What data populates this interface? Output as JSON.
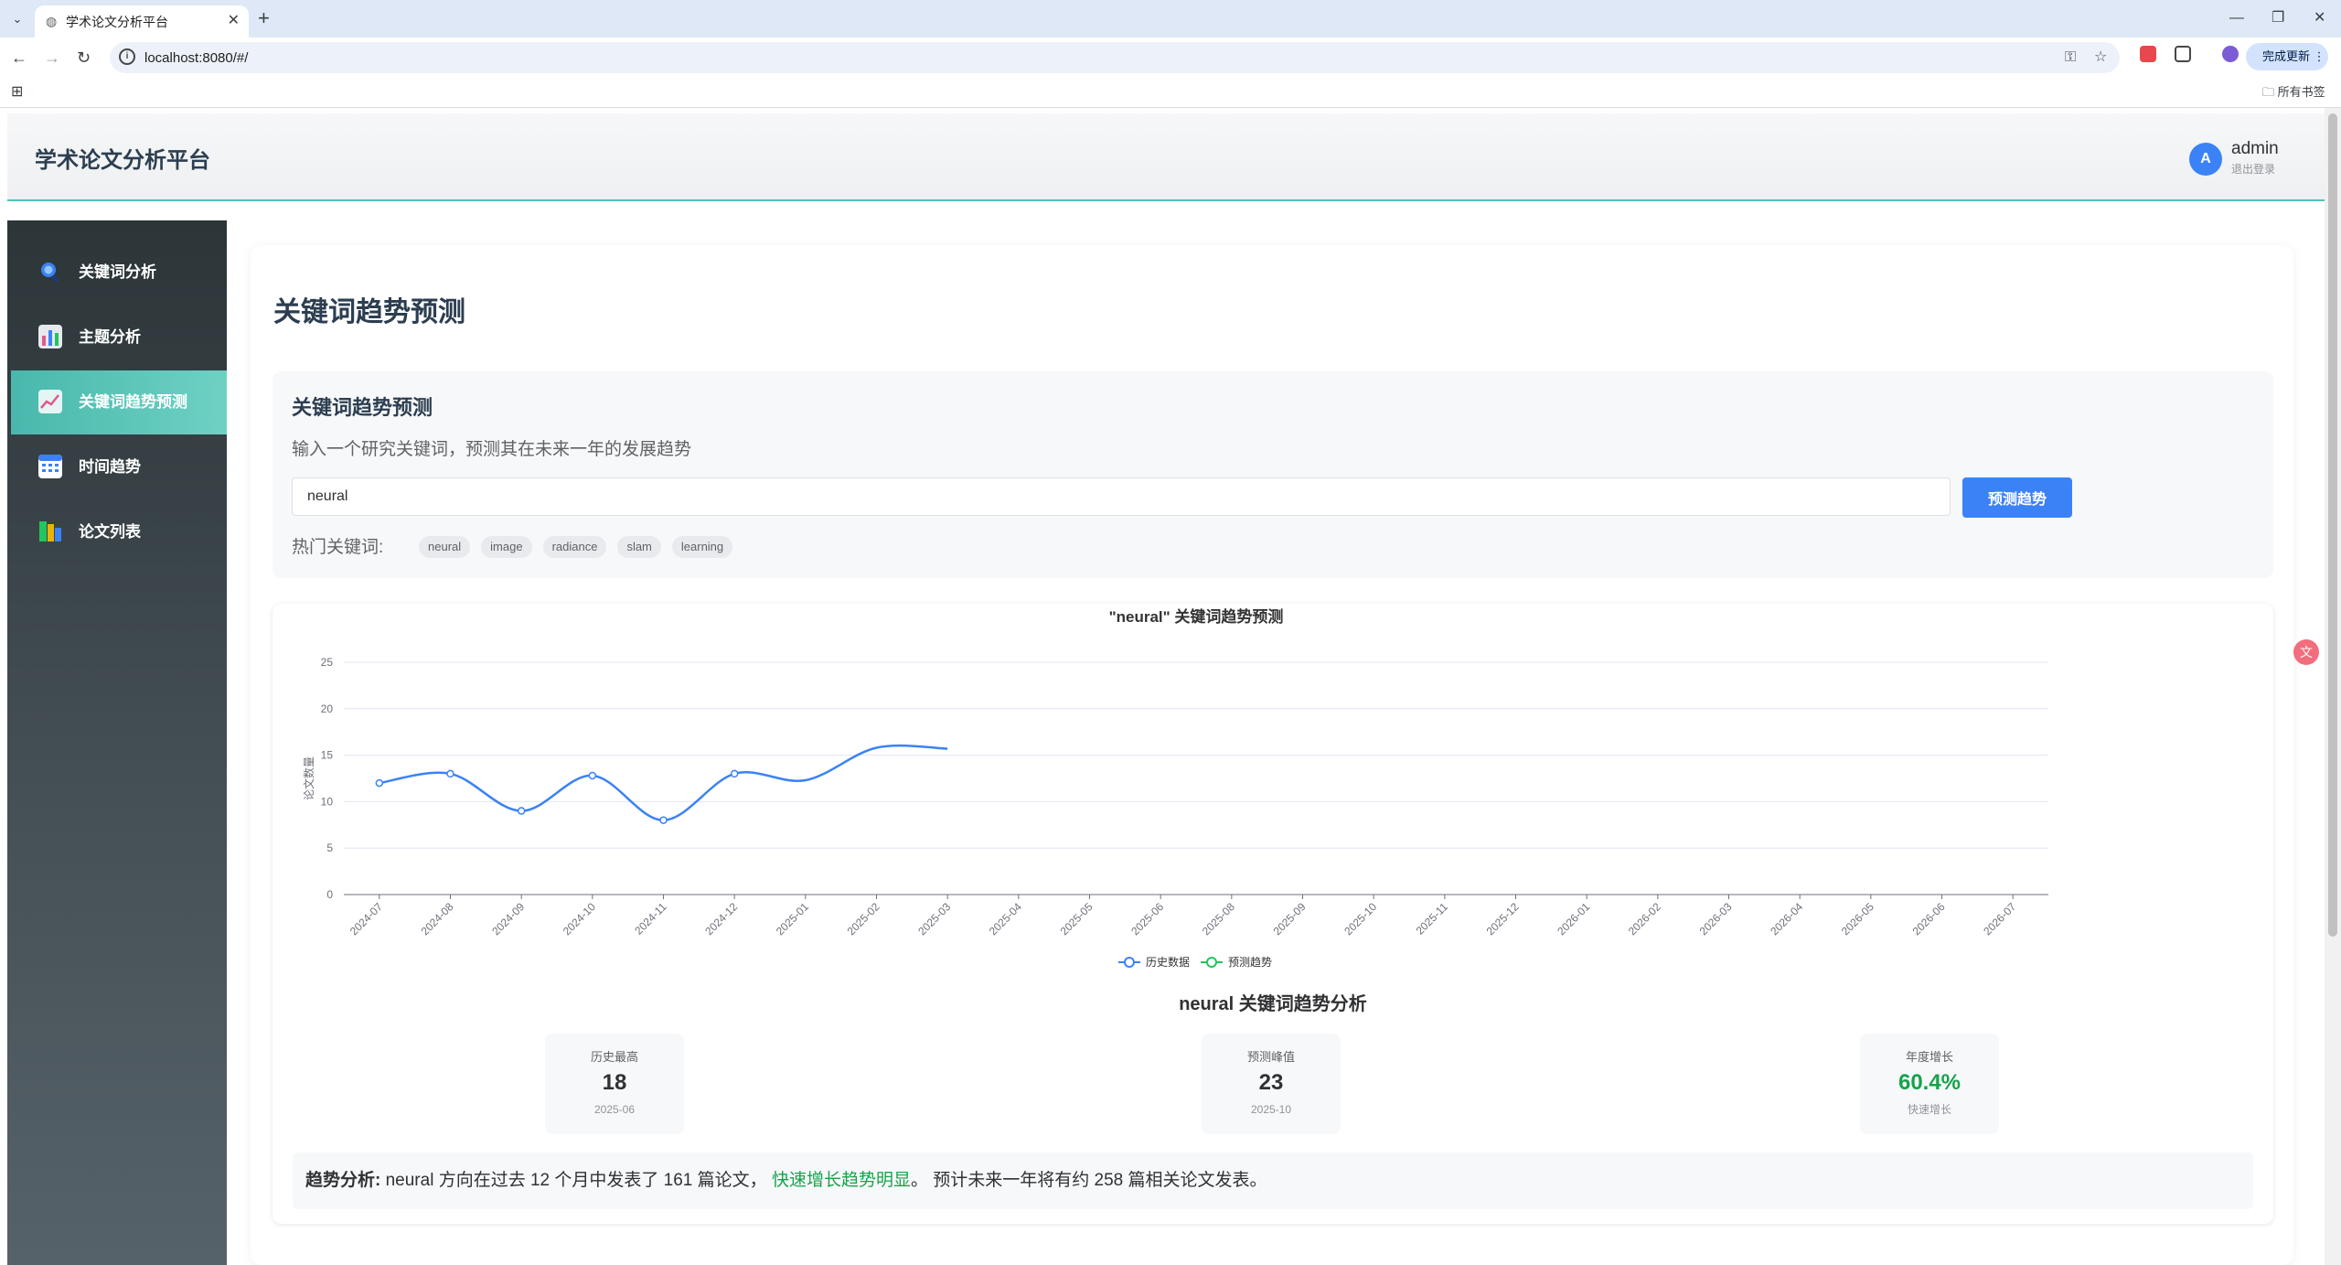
{
  "browser": {
    "tab_title": "学术论文分析平台",
    "url": "localhost:8080/#/",
    "update_label": "完成更新",
    "bookmarks_all": "所有书签"
  },
  "header": {
    "app_title": "学术论文分析平台",
    "avatar_letter": "A",
    "username": "admin",
    "logout": "退出登录"
  },
  "sidebar": {
    "items": [
      {
        "label": "关键词分析",
        "icon": "search-icon",
        "color": "#3b82f6"
      },
      {
        "label": "主题分析",
        "icon": "bar-chart-icon",
        "color": "#e05a8a"
      },
      {
        "label": "关键词趋势预测",
        "icon": "trend-chart-icon",
        "color": "#ffffff"
      },
      {
        "label": "时间趋势",
        "icon": "calendar-icon",
        "color": "#3b82f6"
      },
      {
        "label": "论文列表",
        "icon": "books-icon",
        "color": "#22c55e"
      }
    ],
    "active_index": 2
  },
  "main": {
    "page_title": "关键词趋势预测",
    "search": {
      "heading": "关键词趋势预测",
      "description": "输入一个研究关键词，预测其在未来一年的发展趋势",
      "input_value": "neural",
      "button_label": "预测趋势",
      "hot_label": "热门关键词:",
      "hot_keywords": [
        "neural",
        "image",
        "radiance",
        "slam",
        "learning"
      ]
    },
    "analysis": {
      "title": "neural 关键词趋势分析",
      "stats": [
        {
          "label": "历史最高",
          "value": "18",
          "sub": "2025-06"
        },
        {
          "label": "预测峰值",
          "value": "23",
          "sub": "2025-10"
        },
        {
          "label": "年度增长",
          "value": "60.4%",
          "sub": "快速增长"
        }
      ],
      "summary_label": "趋势分析:",
      "summary_part1": "neural 方向在过去 12 个月中发表了 161 篇论文，",
      "summary_highlight": "快速增长趋势明显",
      "summary_part2": "。 预计未来一年将有约 258 篇相关论文发表。"
    }
  },
  "chart_data": {
    "type": "line",
    "title": "\"neural\" 关键词趋势预测",
    "ylabel": "论文数量",
    "xlabel": "",
    "ylim": [
      0,
      25
    ],
    "yticks": [
      0,
      5,
      10,
      15,
      20,
      25
    ],
    "categories": [
      "2024-07",
      "2024-08",
      "2024-09",
      "2024-10",
      "2024-11",
      "2024-12",
      "2025-01",
      "2025-02",
      "2025-03",
      "2025-04",
      "2025-05",
      "2025-06",
      "2025-08",
      "2025-09",
      "2025-10",
      "2025-11",
      "2025-12",
      "2026-01",
      "2026-02",
      "2026-03",
      "2026-04",
      "2026-05",
      "2026-06",
      "2026-07"
    ],
    "series": [
      {
        "name": "历史数据",
        "color": "#3b82f6",
        "values": [
          12,
          13,
          9,
          12.8,
          8,
          13,
          12.3,
          15.8,
          15.7
        ]
      },
      {
        "name": "预测趋势",
        "color": "#22c55e",
        "values": []
      }
    ],
    "legend": "bottom-center",
    "grid": true
  }
}
